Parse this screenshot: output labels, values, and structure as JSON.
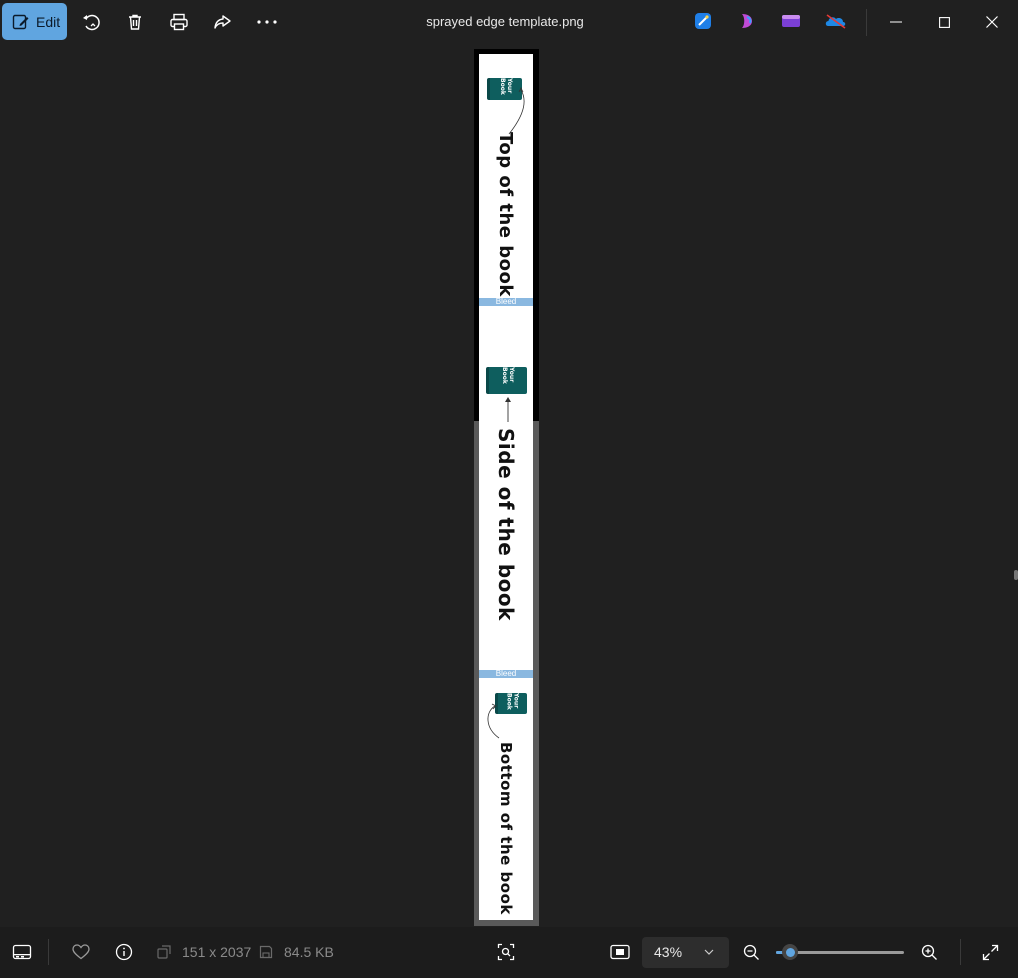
{
  "toolbar": {
    "edit_label": "Edit",
    "icons": [
      "edit-icon",
      "rotate-icon",
      "delete-icon",
      "print-icon",
      "share-icon",
      "more-icon"
    ]
  },
  "window": {
    "title": "sprayed edge template.png",
    "app_icons": [
      "designer-icon",
      "copilot-icon",
      "clipchamp-icon",
      "onedrive-icon"
    ]
  },
  "image": {
    "sections": [
      {
        "label": "Top of the book",
        "book_label": "Your Book"
      },
      {
        "label": "Bleed"
      },
      {
        "label": "Side of the book",
        "book_label": "Your Book"
      },
      {
        "label": "Bleed"
      },
      {
        "label": "Bottom of the book",
        "book_label": "Your Book"
      }
    ]
  },
  "statusbar": {
    "dimensions": "151 x 2037",
    "file_size": "84.5 KB",
    "zoom": "43%",
    "zoom_slider_fraction": 0.11
  },
  "colors": {
    "accent": "#60a5e0",
    "background": "#202020",
    "bleed": "#8ab8e0",
    "book": "#0e5e5e"
  }
}
